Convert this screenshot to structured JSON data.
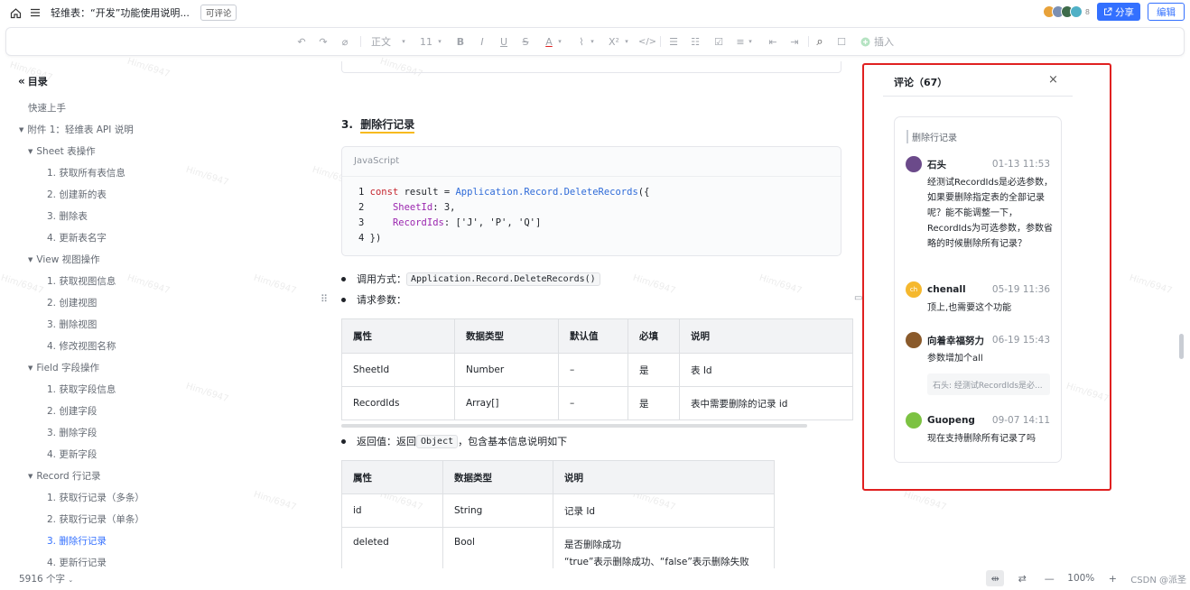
{
  "topbar": {
    "doc_title": "轻维表：“开发”功能使用说明...",
    "comment_tag": "可评论",
    "avatar_count": "8",
    "share_label": "分享",
    "edit_label": "编辑"
  },
  "toolbar": {
    "undo_icon": "↶",
    "redo_icon": "↷",
    "format_painter_icon": "⌀",
    "style_label": "正文",
    "size_label": "11",
    "bold": "B",
    "italic": "I",
    "underline": "U",
    "strike": "S",
    "font_color": "A",
    "highlight": "⌇",
    "superscript": "X²",
    "code": "</>",
    "bullet_list": "☰",
    "numbered_list": "☷",
    "checkbox": "☑",
    "align": "≡",
    "outdent": "⇤",
    "indent": "⇥",
    "search_icon": "⌕",
    "comment_icon": "☐",
    "insert_label": "插入"
  },
  "toc": {
    "title": "目录",
    "items": [
      {
        "label": "快速上手",
        "level": 0
      },
      {
        "label": "附件 1：轻维表 API 说明",
        "level": 0,
        "caret": true
      },
      {
        "label": "Sheet 表操作",
        "level": 1,
        "caret": true
      },
      {
        "label": "1.  获取所有表信息",
        "level": 2
      },
      {
        "label": "2.  创建新的表",
        "level": 2
      },
      {
        "label": "3.  删除表",
        "level": 2
      },
      {
        "label": "4.  更新表名字",
        "level": 2
      },
      {
        "label": "View 视图操作",
        "level": 1,
        "caret": true
      },
      {
        "label": "1.  获取视图信息",
        "level": 2
      },
      {
        "label": "2.  创建视图",
        "level": 2
      },
      {
        "label": "3.  删除视图",
        "level": 2
      },
      {
        "label": "4.  修改视图名称",
        "level": 2
      },
      {
        "label": "Field 字段操作",
        "level": 1,
        "caret": true
      },
      {
        "label": "1.  获取字段信息",
        "level": 2
      },
      {
        "label": "2.  创建字段",
        "level": 2
      },
      {
        "label": "3.  删除字段",
        "level": 2
      },
      {
        "label": "4.  更新字段",
        "level": 2
      },
      {
        "label": "Record 行记录",
        "level": 1,
        "caret": true
      },
      {
        "label": "1.  获取行记录（多条）",
        "level": 2
      },
      {
        "label": "2.  获取行记录（单条）",
        "level": 2
      },
      {
        "label": "3.  删除行记录",
        "level": 2,
        "active": true
      },
      {
        "label": "4.  更新行记录",
        "level": 2
      }
    ],
    "word_count": "5916 个字"
  },
  "main": {
    "heading_number": "3.",
    "heading": "删除行记录",
    "code_lang": "JavaScript",
    "code_lines": [
      {
        "no": "1",
        "a": "const",
        "b": " result = ",
        "c": "Application.Record.DeleteRecords",
        "d": "({"
      },
      {
        "no": "2",
        "a": "    SheetId",
        "b": ": 3,"
      },
      {
        "no": "3",
        "a": "    RecordIds",
        "b": ": ['J', 'P', 'Q']"
      },
      {
        "no": "4",
        "a": "})"
      }
    ],
    "call_label": "调用方式：",
    "call_code": "Application.Record.DeleteRecords()",
    "params_label": "请求参数：",
    "params_table": {
      "headers": [
        "属性",
        "数据类型",
        "默认值",
        "必填",
        "说明"
      ],
      "rows": [
        [
          "SheetId",
          "Number",
          "–",
          "是",
          "表 Id"
        ],
        [
          "RecordIds",
          "Array[]",
          "–",
          "是",
          "表中需要删除的记录 id"
        ]
      ]
    },
    "return_prefix": "返回值：返回",
    "return_code": "Object",
    "return_suffix": "，包含基本信息说明如下",
    "return_table": {
      "headers": [
        "属性",
        "数据类型",
        "说明"
      ],
      "rows": [
        [
          "id",
          "String",
          "记录 Id"
        ],
        [
          "deleted",
          "Bool",
          "是否删除成功"
        ]
      ],
      "deleted_note": "“true”表示删除成功、“false”表示删除失败"
    }
  },
  "comments": {
    "title": "评论（67）",
    "close": "×",
    "quote": "删除行记录",
    "items": [
      {
        "name": "石头",
        "time": "01-13 11:53",
        "text": "经测试RecordIds是必选参数，如果要删除指定表的全部记录呢？能不能调整一下，RecordIds为可选参数，参数省略的时候删除所有记录？",
        "avatar_color": "#6b4a8a"
      },
      {
        "name": "chenall",
        "time": "05-19 11:36",
        "text": "顶上,也需要这个功能",
        "avatar_color": "#f5b82e",
        "avatar_text": "ch"
      },
      {
        "name": "向着幸福努力",
        "time": "06-19 15:43",
        "text": "参数增加个all",
        "avatar_color": "#8a5a2b",
        "reply_quote": "石头: 经测试RecordIds是必..."
      },
      {
        "name": "Guopeng",
        "time": "09-07 14:11",
        "text": "现在支持删除所有记录了吗",
        "avatar_color": "#7cc242"
      }
    ]
  },
  "footer": {
    "zoom": "100%",
    "minus": "—",
    "plus": "+",
    "watermark_text": "CSDN @派圣"
  },
  "watermark": "Him/6947"
}
